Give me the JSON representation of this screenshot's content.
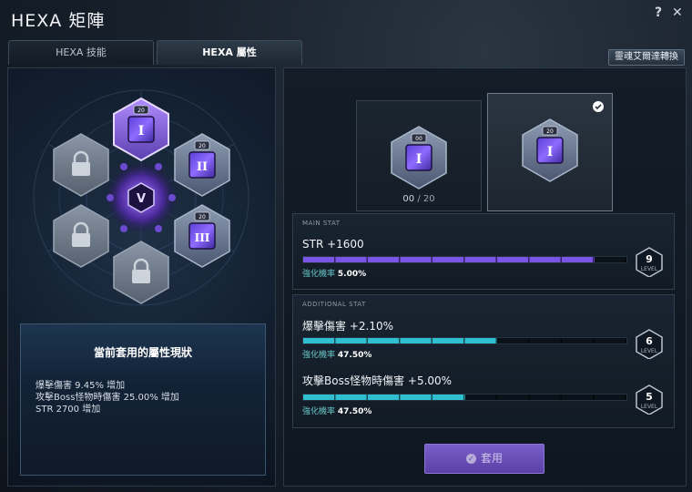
{
  "window": {
    "title": "HEXA 矩陣",
    "help": "?",
    "close": "✕"
  },
  "tabs": [
    {
      "label": "HEXA 技能",
      "active": false
    },
    {
      "label": "HEXA 屬性",
      "active": true
    }
  ],
  "soul_button": "靈魂艾爾達轉換",
  "hex_grid": {
    "center_icon": "v-emblem-icon",
    "slots": [
      {
        "type": "stat",
        "numeral": "I",
        "level_badge": "20",
        "selected": true
      },
      {
        "type": "stat",
        "numeral": "II",
        "level_badge": "20",
        "selected": false
      },
      {
        "type": "stat",
        "numeral": "III",
        "level_badge": "20",
        "selected": false
      },
      {
        "type": "locked",
        "icon": "lock-icon"
      },
      {
        "type": "locked",
        "icon": "lock-icon"
      },
      {
        "type": "locked",
        "icon": "lock-icon"
      }
    ]
  },
  "status_panel": {
    "title": "當前套用的屬性現狀",
    "lines": [
      "爆擊傷害 9.45% 增加",
      "攻擊Boss怪物時傷害 25.00% 增加",
      "STR 2700 增加"
    ]
  },
  "cards": [
    {
      "numeral": "I",
      "badge": "00",
      "count": "00",
      "sep": "/",
      "max": "20",
      "selected": false
    },
    {
      "numeral": "I",
      "badge": "20",
      "selected": true,
      "check_icon": "checkmark-icon"
    }
  ],
  "main_stat": {
    "header": "MAIN STAT",
    "name": "STR +1600",
    "rate_label": "強化機率",
    "rate": "5.00%",
    "level": "9",
    "level_label": "LEVEL",
    "progress": 0.9,
    "color": "#7a56e8"
  },
  "additional": {
    "header": "ADDITIONAL STAT",
    "stats": [
      {
        "name": "爆擊傷害 +2.10%",
        "rate_label": "強化機率",
        "rate": "47.50%",
        "level": "6",
        "level_label": "LEVEL",
        "progress": 0.6,
        "color": "#2fbfd0"
      },
      {
        "name": "攻擊Boss怪物時傷害 +5.00%",
        "rate_label": "強化機率",
        "rate": "47.50%",
        "level": "5",
        "level_label": "LEVEL",
        "progress": 0.5,
        "color": "#2fbfd0"
      }
    ]
  },
  "apply_button": {
    "icon": "check-circle-icon",
    "label": "套用"
  }
}
